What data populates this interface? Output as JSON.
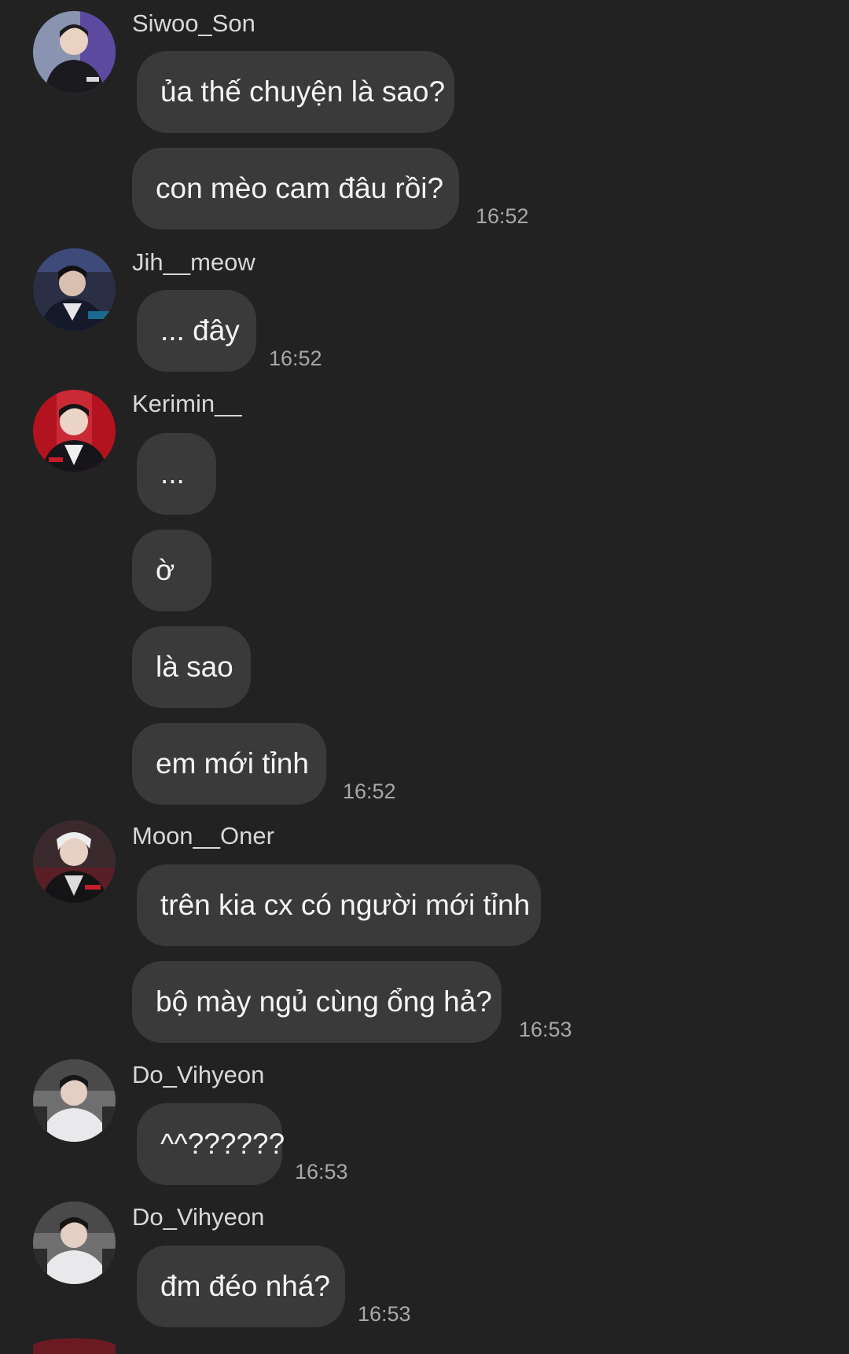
{
  "messages": [
    {
      "sender": "Siwoo_Son",
      "avatar_icon": "user-avatar-siwoo",
      "bubbles": [
        "ủa thế chuyện là sao?",
        "con mèo cam đâu rồi?"
      ],
      "time": "16:52"
    },
    {
      "sender": "Jih__meow",
      "avatar_icon": "user-avatar-jih",
      "bubbles": [
        "... đây"
      ],
      "time": "16:52"
    },
    {
      "sender": "Kerimin__",
      "avatar_icon": "user-avatar-kerimin",
      "bubbles": [
        "...",
        "ờ",
        "là sao",
        "em mới tỉnh"
      ],
      "time": "16:52"
    },
    {
      "sender": "Moon__Oner",
      "avatar_icon": "user-avatar-moon",
      "bubbles": [
        "trên kia cx có người mới tỉnh",
        "bộ mày ngủ cùng ổng hả?"
      ],
      "time": "16:53"
    },
    {
      "sender": "Do_Vihyeon",
      "avatar_icon": "user-avatar-vihyeon",
      "bubbles": [
        "^^??????"
      ],
      "time": "16:53"
    },
    {
      "sender": "Do_Vihyeon",
      "avatar_icon": "user-avatar-vihyeon",
      "bubbles": [
        "đm đéo nhá?"
      ],
      "time": "16:53"
    }
  ],
  "colors": {
    "background": "#222222",
    "bubble": "#3a3a3a",
    "bubble_text": "#f4f4f4",
    "sender_text": "#d8d8d8",
    "time_text": "#a8a8a8"
  }
}
